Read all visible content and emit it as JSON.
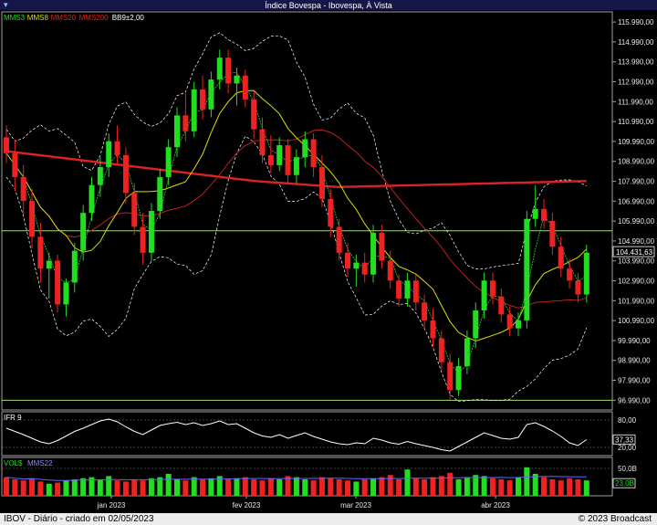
{
  "window": {
    "title": "Índice Bovespa - Ibovespa, À Vista",
    "menu_glyph": "▾"
  },
  "main": {
    "legend": [
      {
        "label": "MMS3",
        "color": "#22dd22"
      },
      {
        "label": "MMS8",
        "color": "#dddd00"
      },
      {
        "label": "MMS20",
        "color": "#dd2222"
      },
      {
        "label": "MMS200",
        "color": "#dd2222"
      },
      {
        "label": "BB9±2,00",
        "color": "#ffffff"
      }
    ],
    "y_ticks": [
      "115.990,00",
      "114.990,00",
      "113.990,00",
      "112.990,00",
      "111.990,00",
      "110.990,00",
      "109.990,00",
      "108.990,00",
      "107.990,00",
      "106.990,00",
      "105.990,00",
      "104.990,00",
      "103.990,00",
      "102.990,00",
      "101.990,00",
      "100.990,00",
      "99.990,00",
      "98.990,00",
      "97.990,00",
      "96.990,00"
    ],
    "last_price": "104.431,63"
  },
  "ifr": {
    "title": "IFR 9",
    "levels": [
      "80,00",
      "20,00"
    ],
    "current": "37,33"
  },
  "vol": {
    "title": "VOL$",
    "ma_label": "MMS22",
    "level": "50,0B",
    "current": "23,0B"
  },
  "x_ticks": [
    "jan 2023",
    "fev 2023",
    "mar 2023",
    "abr 2023"
  ],
  "footer": {
    "left": "IBOV - Diário - criado em 02/05/2023",
    "right": "© 2023 Broadcast"
  },
  "colors": {
    "up": "#22dd22",
    "down": "#ee2222",
    "frame": "#a0a0a0",
    "guide": "#9be07a"
  },
  "chart_data": {
    "type": "candlestick",
    "symbol": "IBOV",
    "ylim": [
      96500,
      116500
    ],
    "candles": [
      {
        "o": 110200,
        "h": 110800,
        "l": 108900,
        "c": 109400
      },
      {
        "o": 109400,
        "h": 110100,
        "l": 107500,
        "c": 108200
      },
      {
        "o": 108200,
        "h": 108800,
        "l": 106300,
        "c": 107000
      },
      {
        "o": 107000,
        "h": 107600,
        "l": 104600,
        "c": 105200
      },
      {
        "o": 105200,
        "h": 105900,
        "l": 102900,
        "c": 103600
      },
      {
        "o": 103600,
        "h": 104400,
        "l": 102100,
        "c": 104000
      },
      {
        "o": 104000,
        "h": 104300,
        "l": 101400,
        "c": 101800
      },
      {
        "o": 101800,
        "h": 103100,
        "l": 101200,
        "c": 102900
      },
      {
        "o": 102900,
        "h": 104900,
        "l": 102400,
        "c": 104500
      },
      {
        "o": 104500,
        "h": 106800,
        "l": 104000,
        "c": 106400
      },
      {
        "o": 106400,
        "h": 108200,
        "l": 106000,
        "c": 107800
      },
      {
        "o": 107800,
        "h": 109200,
        "l": 107200,
        "c": 108700
      },
      {
        "o": 108700,
        "h": 110400,
        "l": 108200,
        "c": 110000
      },
      {
        "o": 110000,
        "h": 110800,
        "l": 108800,
        "c": 109300
      },
      {
        "o": 109300,
        "h": 109700,
        "l": 106900,
        "c": 107400
      },
      {
        "o": 107400,
        "h": 107900,
        "l": 105300,
        "c": 105700
      },
      {
        "o": 105700,
        "h": 106400,
        "l": 103800,
        "c": 104400
      },
      {
        "o": 104400,
        "h": 106900,
        "l": 104000,
        "c": 106500
      },
      {
        "o": 106500,
        "h": 108600,
        "l": 106100,
        "c": 108200
      },
      {
        "o": 108200,
        "h": 110100,
        "l": 107800,
        "c": 109700
      },
      {
        "o": 109700,
        "h": 111700,
        "l": 109200,
        "c": 111300
      },
      {
        "o": 111300,
        "h": 112400,
        "l": 110000,
        "c": 110500
      },
      {
        "o": 110500,
        "h": 113000,
        "l": 110200,
        "c": 112600
      },
      {
        "o": 112600,
        "h": 113300,
        "l": 111100,
        "c": 111600
      },
      {
        "o": 111600,
        "h": 113500,
        "l": 111200,
        "c": 113100
      },
      {
        "o": 113100,
        "h": 114600,
        "l": 112600,
        "c": 114200
      },
      {
        "o": 114200,
        "h": 114600,
        "l": 112400,
        "c": 112900
      },
      {
        "o": 112900,
        "h": 113700,
        "l": 111800,
        "c": 113300
      },
      {
        "o": 113300,
        "h": 113600,
        "l": 111700,
        "c": 112100
      },
      {
        "o": 112100,
        "h": 112500,
        "l": 110100,
        "c": 110600
      },
      {
        "o": 110600,
        "h": 111200,
        "l": 108900,
        "c": 109300
      },
      {
        "o": 109300,
        "h": 110300,
        "l": 108400,
        "c": 108800
      },
      {
        "o": 108800,
        "h": 110200,
        "l": 108500,
        "c": 109800
      },
      {
        "o": 109800,
        "h": 110100,
        "l": 107900,
        "c": 108300
      },
      {
        "o": 108300,
        "h": 109600,
        "l": 107900,
        "c": 109200
      },
      {
        "o": 109200,
        "h": 110500,
        "l": 108700,
        "c": 110100
      },
      {
        "o": 110100,
        "h": 110400,
        "l": 108200,
        "c": 108700
      },
      {
        "o": 108700,
        "h": 109300,
        "l": 106700,
        "c": 107100
      },
      {
        "o": 107100,
        "h": 107600,
        "l": 105200,
        "c": 105700
      },
      {
        "o": 105700,
        "h": 106100,
        "l": 104000,
        "c": 104400
      },
      {
        "o": 104400,
        "h": 104900,
        "l": 103200,
        "c": 103600
      },
      {
        "o": 103600,
        "h": 104300,
        "l": 102700,
        "c": 103900
      },
      {
        "o": 103900,
        "h": 104400,
        "l": 102900,
        "c": 103300
      },
      {
        "o": 103300,
        "h": 105800,
        "l": 102900,
        "c": 105400
      },
      {
        "o": 105400,
        "h": 105800,
        "l": 103600,
        "c": 104000
      },
      {
        "o": 104000,
        "h": 104500,
        "l": 102600,
        "c": 103000
      },
      {
        "o": 103000,
        "h": 103300,
        "l": 101700,
        "c": 102100
      },
      {
        "o": 102100,
        "h": 103400,
        "l": 101700,
        "c": 103000
      },
      {
        "o": 103000,
        "h": 103300,
        "l": 101500,
        "c": 101900
      },
      {
        "o": 101900,
        "h": 102300,
        "l": 100600,
        "c": 101000
      },
      {
        "o": 101000,
        "h": 101600,
        "l": 99700,
        "c": 100100
      },
      {
        "o": 100100,
        "h": 100500,
        "l": 98500,
        "c": 98900
      },
      {
        "o": 98900,
        "h": 99300,
        "l": 97000,
        "c": 97500
      },
      {
        "o": 97500,
        "h": 99100,
        "l": 97200,
        "c": 98700
      },
      {
        "o": 98700,
        "h": 100500,
        "l": 98300,
        "c": 100100
      },
      {
        "o": 100100,
        "h": 101900,
        "l": 99600,
        "c": 101500
      },
      {
        "o": 101500,
        "h": 103400,
        "l": 101100,
        "c": 103000
      },
      {
        "o": 103000,
        "h": 103400,
        "l": 101800,
        "c": 102200
      },
      {
        "o": 102200,
        "h": 102600,
        "l": 100900,
        "c": 101300
      },
      {
        "o": 101300,
        "h": 101700,
        "l": 100200,
        "c": 100600
      },
      {
        "o": 100600,
        "h": 101400,
        "l": 100200,
        "c": 101000
      },
      {
        "o": 101000,
        "h": 106500,
        "l": 100600,
        "c": 106100
      },
      {
        "o": 106100,
        "h": 107800,
        "l": 105700,
        "c": 106600
      },
      {
        "o": 106600,
        "h": 107100,
        "l": 105600,
        "c": 106000
      },
      {
        "o": 106000,
        "h": 106400,
        "l": 104300,
        "c": 104700
      },
      {
        "o": 104700,
        "h": 105200,
        "l": 103200,
        "c": 103600
      },
      {
        "o": 103600,
        "h": 104100,
        "l": 102600,
        "c": 103000
      },
      {
        "o": 103000,
        "h": 103400,
        "l": 101900,
        "c": 102300
      },
      {
        "o": 102300,
        "h": 104800,
        "l": 101900,
        "c": 104400
      }
    ],
    "mms200": [
      109500,
      109000,
      108500,
      108000,
      107700,
      107800,
      107900,
      108000
    ],
    "ifr": [
      62,
      55,
      48,
      40,
      32,
      28,
      35,
      45,
      55,
      62,
      70,
      78,
      82,
      76,
      65,
      55,
      48,
      58,
      68,
      72,
      75,
      70,
      74,
      68,
      72,
      78,
      70,
      72,
      62,
      52,
      45,
      42,
      48,
      40,
      46,
      52,
      44,
      38,
      32,
      28,
      26,
      30,
      28,
      40,
      36,
      30,
      27,
      33,
      28,
      24,
      20,
      15,
      12,
      22,
      32,
      42,
      52,
      46,
      40,
      38,
      42,
      70,
      74,
      66,
      56,
      44,
      30,
      24,
      37
    ],
    "volume": [
      34,
      30,
      28,
      32,
      26,
      22,
      24,
      28,
      30,
      32,
      34,
      30,
      36,
      28,
      26,
      30,
      28,
      32,
      34,
      40,
      30,
      28,
      34,
      30,
      32,
      36,
      30,
      32,
      34,
      30,
      28,
      32,
      30,
      36,
      34,
      30,
      28,
      34,
      32,
      30,
      28,
      26,
      30,
      32,
      34,
      38,
      30,
      48,
      32,
      30,
      34,
      36,
      42,
      30,
      34,
      38,
      36,
      32,
      30,
      28,
      34,
      52,
      40,
      34,
      30,
      28,
      32,
      30,
      28
    ]
  }
}
